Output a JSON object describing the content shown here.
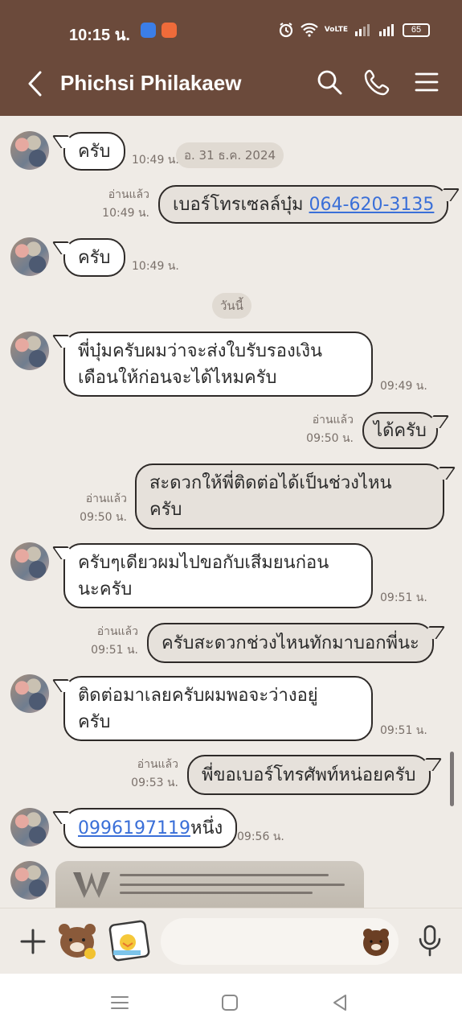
{
  "status_bar": {
    "time": "10:15 น.",
    "battery": "65",
    "network": "VoLTE"
  },
  "header": {
    "contact_name": "Phichsi Philakaew"
  },
  "messages": [
    {
      "side": "in",
      "text": "ครับ",
      "time": "10:49 น."
    },
    {
      "side": "out",
      "text_prefix": "เบอร์โทรเซลล์บุ๋ม ",
      "link": "064-620-3135",
      "read": "อ่านแล้ว",
      "time": "10:49 น."
    },
    {
      "side": "in",
      "text": "ครับ",
      "time": "10:49 น."
    },
    {
      "side": "in",
      "text_lines": [
        "พี่บุ๋มครับผมว่าจะส่งใบรับรองเงิน",
        "เดือนให้ก่อนจะได้ไหมครับ"
      ],
      "time": "09:49 น."
    },
    {
      "side": "out",
      "text": "ได้ครับ",
      "read": "อ่านแล้ว",
      "time": "09:50 น."
    },
    {
      "side": "out",
      "text_lines": [
        "สะดวกให้พี่ติดต่อได้เป็นช่วงไหน",
        "ครับ"
      ],
      "read": "อ่านแล้ว",
      "time": "09:50 น."
    },
    {
      "side": "in",
      "text_lines": [
        "ครับๆเดียวผมไปขอกับเสีมยนก่อน",
        "นะครับ"
      ],
      "time": "09:51 น."
    },
    {
      "side": "out",
      "text": "ครับสะดวกช่วงไหนทักมาบอกพี่นะ",
      "read": "อ่านแล้ว",
      "time": "09:51 น."
    },
    {
      "side": "in",
      "text_lines": [
        "ติดต่อมาเลยครับผมพอจะว่างอยู่",
        "ครับ"
      ],
      "time": "09:51 น."
    },
    {
      "side": "out",
      "text": "พี่ขอเบอร์โทรศัพท์หน่อยครับ",
      "read": "อ่านแล้ว",
      "time": "09:53 น."
    },
    {
      "side": "in",
      "link": "0996197119",
      "text_suffix": "หนึ่ง",
      "time": "09:56 น."
    }
  ],
  "date_pills": {
    "floating": "อ. 31 ธ.ค. 2024",
    "today": "วันนี้"
  },
  "colors": {
    "header_bg": "#6b4a3b",
    "chat_bg": "#efebe6",
    "link": "#3a6fd8",
    "outgoing_bubble": "#e6e1db",
    "incoming_bubble": "#ffffff"
  },
  "input_bar": {
    "placeholder": ""
  },
  "icons": {
    "back": "chevron-left-icon",
    "search": "search-icon",
    "call": "phone-icon",
    "menu": "hamburger-icon",
    "add": "plus-icon",
    "sticker1": "bear-sticker-icon",
    "sticker2": "photo-sticker-icon",
    "emoji": "bear-emoji-icon",
    "mic": "mic-icon"
  }
}
